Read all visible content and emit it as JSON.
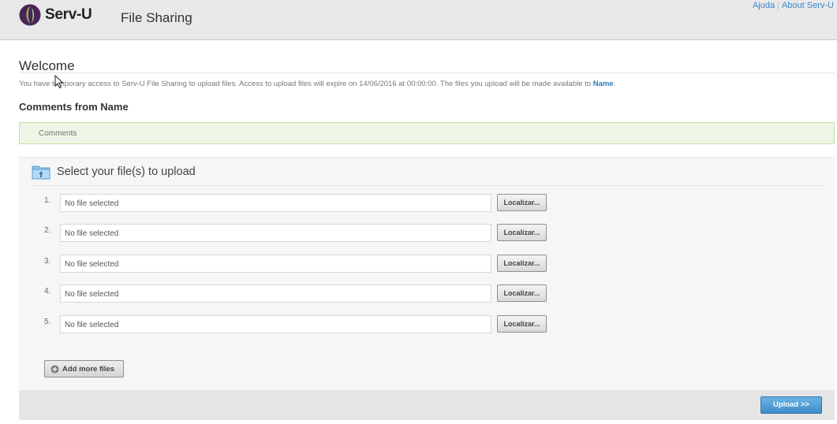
{
  "header": {
    "logo_text": "Serv-U",
    "app_title": "File Sharing",
    "links": [
      {
        "label": "Ajuda"
      },
      {
        "label": "About Serv-U"
      }
    ],
    "separator": "|",
    "logo_icon": "serv-u-logo-icon"
  },
  "welcome": {
    "title": "Welcome",
    "notice_text": "You have temporary access to Serv-U File Sharing to upload files. Access to upload files will expire on 14/06/2016 at 00:00:00. The files you upload will be made available to ",
    "recipient": "Name",
    "notice_end": "."
  },
  "comments": {
    "title": "Comments from Name",
    "text": "Comments"
  },
  "upload": {
    "title": "Select your file(s) to upload",
    "folder_icon": "folder-upload-icon",
    "rows": [
      {
        "num": "1.",
        "value": "No file selected",
        "button": "Localizar..."
      },
      {
        "num": "2.",
        "value": "No file selected",
        "button": "Localizar..."
      },
      {
        "num": "3.",
        "value": "No file selected",
        "button": "Localizar..."
      },
      {
        "num": "4.",
        "value": "No file selected",
        "button": "Localizar..."
      },
      {
        "num": "5.",
        "value": "No file selected",
        "button": "Localizar..."
      }
    ],
    "add_more_label": "Add more files",
    "upload_label": "Upload >>"
  },
  "colors": {
    "link": "#3a86c8",
    "comments_bg": "#eef5e4",
    "upload_button": "#4f9ad4",
    "logo_green": "#8cc63f",
    "logo_purple": "#5b2b6e"
  }
}
